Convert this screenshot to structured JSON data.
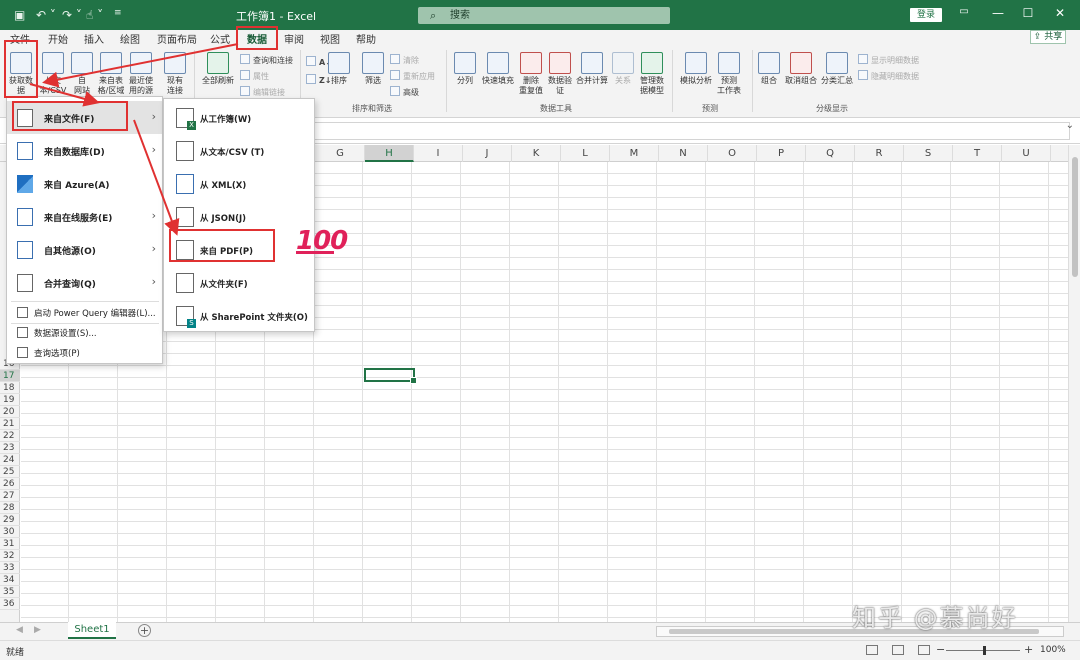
{
  "window": {
    "title": "工作簿1 - Excel",
    "search_placeholder": "搜索",
    "login": "登录"
  },
  "tabs": [
    "文件",
    "开始",
    "插入",
    "绘图",
    "页面布局",
    "公式",
    "数据",
    "审阅",
    "视图",
    "帮助"
  ],
  "active_tab": "数据",
  "share": "共享",
  "ribbon": {
    "get_data": "获取数\n据",
    "from_text_csv": "从文\n本/CSV",
    "from_web": "自\n网站",
    "from_table": "来自表\n格/区域",
    "recent_sources": "最近使\n用的源",
    "existing_connections": "现有\n连接",
    "refresh_all": "全部刷新",
    "queries_connections": "查询和连接",
    "properties": "属性",
    "edit_links": "编辑链接",
    "sort": "排序",
    "filter": "筛选",
    "clear": "清除",
    "reapply": "重新应用",
    "advanced": "高级",
    "group_sort_filter": "排序和筛选",
    "split_column": "分列",
    "flash_fill": "快速填充",
    "remove_duplicates": "删除\n重复值",
    "data_validation": "数据验\n证",
    "consolidate": "合并计算",
    "relationships": "关系",
    "manage_data_model": "管理数\n据模型",
    "group_data_tools": "数据工具",
    "what_if": "模拟分析",
    "forecast_sheet": "预测\n工作表",
    "group_forecast": "预测",
    "group_btn": "组合",
    "ungroup": "取消组合",
    "subtotal": "分类汇总",
    "show_detail": "显示明细数据",
    "hide_detail": "隐藏明细数据",
    "group_outline": "分级显示"
  },
  "columns": [
    "G",
    "H",
    "I",
    "J",
    "K",
    "L",
    "M",
    "N",
    "O",
    "P",
    "Q",
    "R",
    "S",
    "T",
    "U"
  ],
  "selected_column": "H",
  "rows": [
    "16",
    "17",
    "18",
    "19",
    "20",
    "21",
    "22",
    "23",
    "24",
    "25",
    "26",
    "27",
    "28",
    "29",
    "30",
    "31",
    "32",
    "33",
    "34",
    "35",
    "36"
  ],
  "selected_row": "17",
  "menu_get_data": {
    "from_file": "来自文件(F)",
    "from_database": "来自数据库(D)",
    "from_azure": "来自 Azure(A)",
    "from_online_services": "来自在线服务(E)",
    "from_other_sources": "自其他源(O)",
    "combine_queries": "合并查询(Q)",
    "launch_pq_editor": "启动 Power Query 编辑器(L)...",
    "data_source_settings": "数据源设置(S)...",
    "query_options": "查询选项(P)"
  },
  "menu_from_file": {
    "from_workbook": "从工作簿(W)",
    "from_text_csv": "从文本/CSV (T)",
    "from_xml": "从 XML(X)",
    "from_json": "从 JSON(J)",
    "from_pdf": "来自 PDF(P)",
    "from_folder": "从文件夹(F)",
    "from_sharepoint": "从 SharePoint 文件夹(O)"
  },
  "sheets": [
    "Sheet1"
  ],
  "status": "就绪",
  "zoom": "100%",
  "annotation_emoji": "100",
  "watermark": "知乎 @慕尚好",
  "accent_color": "#217346",
  "annotation_color": "#e03131"
}
